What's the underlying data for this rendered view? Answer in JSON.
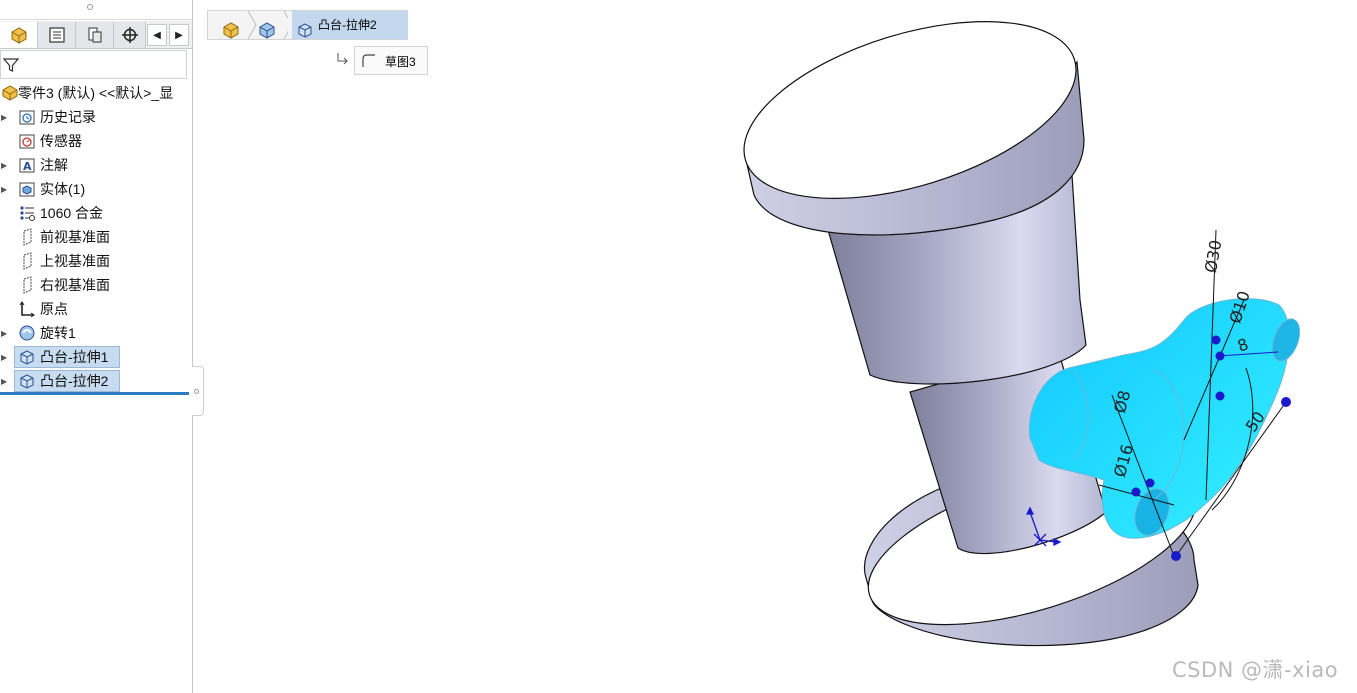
{
  "feature_manager": {
    "tabs": [
      {
        "name": "FeatureManager design tree",
        "icon": "part-tree-icon"
      },
      {
        "name": "PropertyManager",
        "icon": "property-manager-icon"
      },
      {
        "name": "ConfigurationManager",
        "icon": "configuration-manager-icon"
      },
      {
        "name": "DimXpertManager",
        "icon": "crosshair-icon"
      }
    ],
    "filter_icon": "filter-icon",
    "tree": {
      "root": {
        "label": "零件3 (默认) <<默认>_显",
        "icon": "part-icon"
      },
      "items": [
        {
          "label": "历史记录",
          "icon": "history-icon",
          "expandable": true
        },
        {
          "label": "传感器",
          "icon": "sensor-icon",
          "expandable": false
        },
        {
          "label": "注解",
          "icon": "annotation-icon",
          "expandable": true
        },
        {
          "label": "实体(1)",
          "icon": "solid-bodies-icon",
          "expandable": true
        },
        {
          "label": "1060 合金",
          "icon": "material-icon",
          "expandable": false
        },
        {
          "label": "前视基准面",
          "icon": "plane-icon",
          "expandable": false
        },
        {
          "label": "上视基准面",
          "icon": "plane-icon",
          "expandable": false
        },
        {
          "label": "右视基准面",
          "icon": "plane-icon",
          "expandable": false
        },
        {
          "label": "原点",
          "icon": "origin-icon",
          "expandable": false
        },
        {
          "label": "旋转1",
          "icon": "revolve-icon",
          "expandable": true
        },
        {
          "label": "凸台-拉伸1",
          "icon": "extrude-icon",
          "expandable": true,
          "selected": true
        },
        {
          "label": "凸台-拉伸2",
          "icon": "extrude-icon",
          "expandable": true,
          "selected": true
        }
      ]
    }
  },
  "breadcrumb": {
    "items": [
      {
        "icon": "part-icon"
      },
      {
        "icon": "body-icon"
      },
      {
        "icon": "extrude-icon",
        "label": "凸台-拉伸2"
      }
    ],
    "sketch": {
      "label": "草图3",
      "icon": "sketch-icon"
    }
  },
  "viewport": {
    "dimension_labels": [
      "Ø30",
      "Ø10",
      "8",
      "Ø8",
      "Ø16",
      "50"
    ],
    "colors": {
      "selected_face": "#1fe0ff",
      "body_light": "#ffffff",
      "body_shade": "#b8b9d2",
      "sketch_point": "#1a1acc"
    }
  },
  "watermark": "CSDN @潇-xiao"
}
